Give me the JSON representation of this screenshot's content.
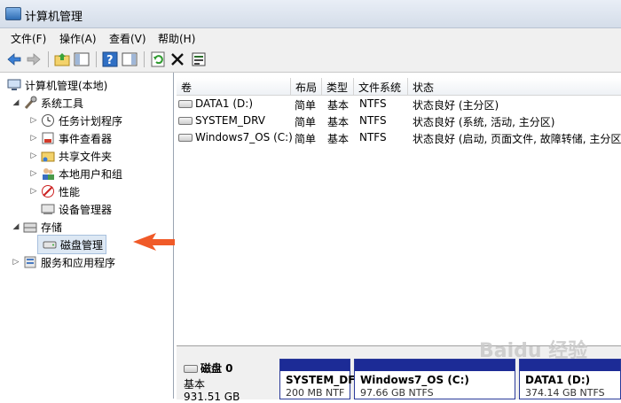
{
  "window": {
    "title": "计算机管理"
  },
  "menu": [
    "文件(F)",
    "操作(A)",
    "查看(V)",
    "帮助(H)"
  ],
  "toolbar": [
    {
      "icon": "back-arrow-icon"
    },
    {
      "icon": "forward-arrow-icon"
    },
    {
      "icon": "up-folder-icon"
    },
    {
      "icon": "show-hide-console-tree-icon"
    },
    {
      "icon": "help-icon"
    },
    {
      "icon": "show-action-pane-icon"
    },
    {
      "icon": "refresh-icon"
    },
    {
      "icon": "delete-x-icon"
    },
    {
      "icon": "properties-icon"
    }
  ],
  "tree": {
    "root": "计算机管理(本地)",
    "system_tools": "系统工具",
    "task_scheduler": "任务计划程序",
    "event_viewer": "事件查看器",
    "shared_folders": "共享文件夹",
    "local_users": "本地用户和组",
    "performance": "性能",
    "device_manager": "设备管理器",
    "storage": "存储",
    "disk_management": "磁盘管理",
    "services_apps": "服务和应用程序"
  },
  "volumes": {
    "columns": [
      "卷",
      "布局",
      "类型",
      "文件系统",
      "状态"
    ],
    "rows": [
      {
        "name": "DATA1 (D:)",
        "layout": "简单",
        "type": "基本",
        "fs": "NTFS",
        "status": "状态良好 (主分区)"
      },
      {
        "name": "SYSTEM_DRV",
        "layout": "简单",
        "type": "基本",
        "fs": "NTFS",
        "status": "状态良好 (系统, 活动, 主分区)"
      },
      {
        "name": "Windows7_OS (C:)",
        "layout": "简单",
        "type": "基本",
        "fs": "NTFS",
        "status": "状态良好 (启动, 页面文件, 故障转储, 主分区)"
      }
    ]
  },
  "disk": {
    "label": "磁盘 0",
    "type": "基本",
    "size": "931.51 GB",
    "partitions": [
      {
        "name": "SYSTEM_DF",
        "size": "200 MB NTF"
      },
      {
        "name": "Windows7_OS  (C:)",
        "size": "97.66 GB NTFS"
      },
      {
        "name": "DATA1  (D:)",
        "size": "374.14 GB NTFS"
      }
    ]
  },
  "colors": {
    "accent": "#1c2b96",
    "arrow": "#f05a28"
  },
  "watermark": "Baidu 经验"
}
